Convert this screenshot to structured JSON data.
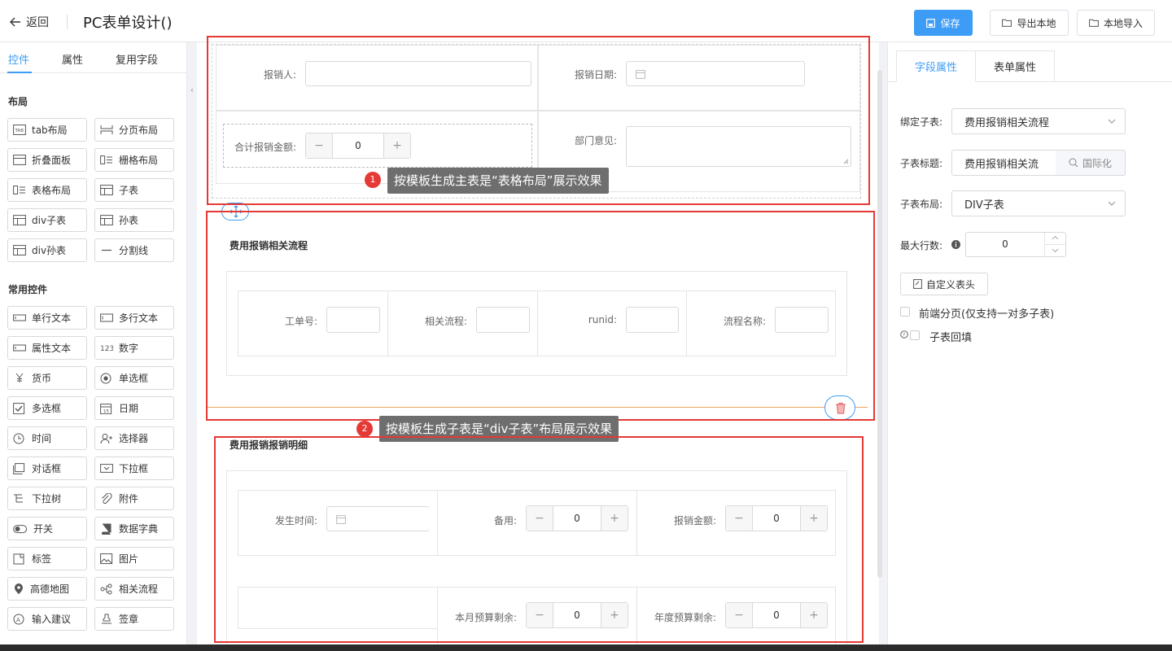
{
  "header": {
    "back_label": "返回",
    "title": "PC表单设计()",
    "save_label": "保存",
    "export_label": "导出本地",
    "import_label": "本地导入"
  },
  "left_panel": {
    "tabs": [
      "控件",
      "属性",
      "复用字段"
    ],
    "layout_section": "布局",
    "layout_items": [
      "tab布局",
      "分页布局",
      "折叠面板",
      "栅格布局",
      "表格布局",
      "子表",
      "div子表",
      "孙表",
      "div孙表",
      "分割线"
    ],
    "common_section": "常用控件",
    "common_items": [
      "单行文本",
      "多行文本",
      "属性文本",
      "数字",
      "货币",
      "单选框",
      "多选框",
      "日期",
      "时间",
      "选择器",
      "对话框",
      "下拉框",
      "下拉树",
      "附件",
      "开关",
      "数据字典",
      "标签",
      "图片",
      "高德地图",
      "相关流程",
      "输入建议",
      "签章"
    ]
  },
  "canvas": {
    "main": {
      "reimburser_label": "报销人:",
      "date_label": "报销日期:",
      "total_label": "合计报销金额:",
      "total_value": "0",
      "dept_opinion_label": "部门意见:"
    },
    "annotation1": {
      "num": "1",
      "text": "按模板生成主表是“表格布局”展示效果"
    },
    "sub1": {
      "title": "费用报销相关流程",
      "fields": [
        "工单号:",
        "相关流程:",
        "runid:",
        "流程名称:"
      ]
    },
    "annotation2": {
      "num": "2",
      "text": "按模板生成子表是“div子表”布局展示效果"
    },
    "sub2": {
      "title": "费用报销报销明细",
      "occur_time_label": "发生时间:",
      "backup_label": "备用:",
      "backup_value": "0",
      "amount_label": "报销金额:",
      "amount_value": "0",
      "month_budget_label": "本月预算剩余:",
      "month_budget_value": "0",
      "year_budget_label": "年度预算剩余:",
      "year_budget_value": "0"
    }
  },
  "right_panel": {
    "tabs": [
      "字段属性",
      "表单属性"
    ],
    "bind_label": "绑定子表:",
    "bind_value": "费用报销相关流程",
    "title_label": "子表标题:",
    "title_value": "费用报销相关流",
    "i18n_label": "国际化",
    "layout_label": "子表布局:",
    "layout_value": "DIV子表",
    "max_rows_label": "最大行数:",
    "max_rows_value": "0",
    "custom_header_label": "自定义表头",
    "paging_label": "前端分页(仅支持一对多子表)",
    "backfill_label": "子表回填"
  },
  "colors": {
    "accent": "#3d9cf5",
    "annotation_red": "#e53935"
  }
}
